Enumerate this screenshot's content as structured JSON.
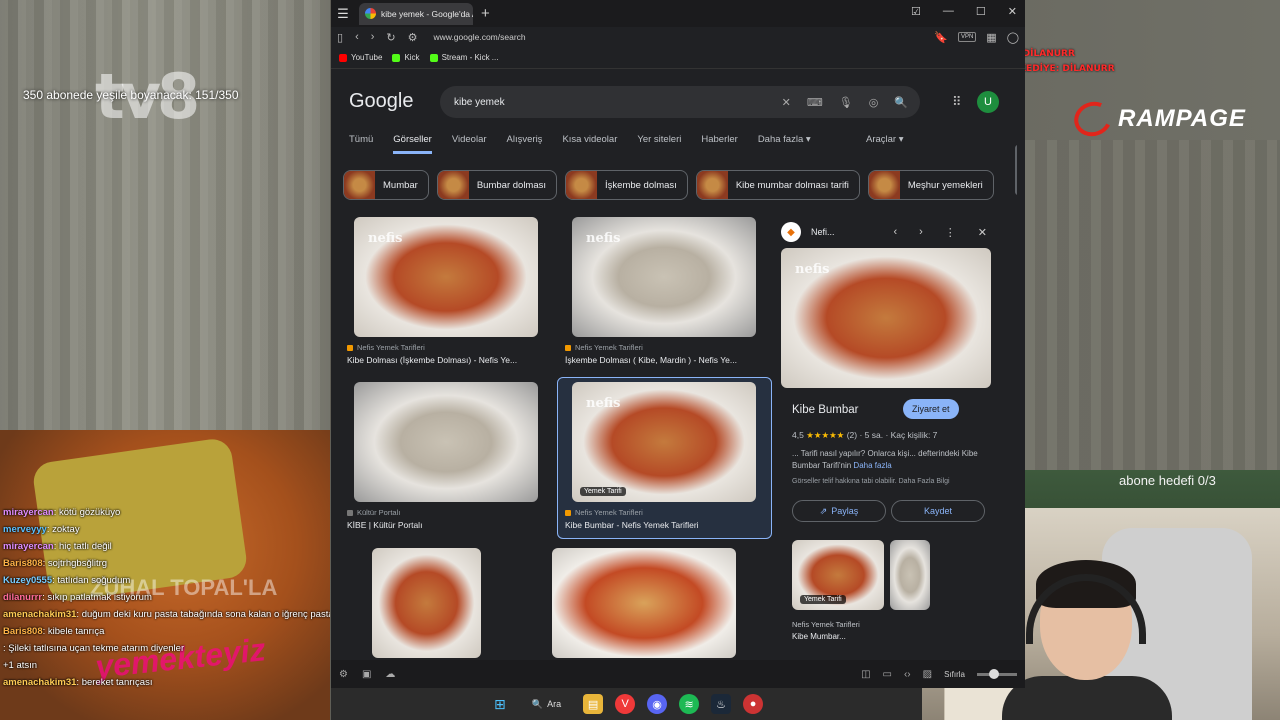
{
  "stream": {
    "abone_top": "350 abonede yeşile boyanacak: 151/350",
    "abone_hedef": "abone hedefi 0/3",
    "son_abone_1": "SON ABONE: DİLANURR",
    "son_abone_2": "SON ABONE KEDİYE: DİLANURR",
    "brand": "RAMPAGE",
    "logo_tv": "tv8",
    "watermark": "yemekteyiz",
    "watermark_top": "ZUHAL TOPAL'LA"
  },
  "chat": [
    {
      "user": "mirayercan",
      "text": ": kötü gözüküyo",
      "color": "#e08cff"
    },
    {
      "user": "merveyyy",
      "text": ": zoktay",
      "color": "#5bc0ff"
    },
    {
      "user": "mirayercan",
      "text": ": hiç tatlı değil",
      "color": "#e08cff"
    },
    {
      "user": "Baris808",
      "text": ": sojtrhgbsğlitrg",
      "color": "#ffb347"
    },
    {
      "user": "Kuzey0555",
      "text": ": tatlıdan soğudum",
      "color": "#7cf"
    },
    {
      "user": "dilanurrr",
      "text": ": sıkıp patlatmak istiyorum",
      "color": "#ff6b9a"
    },
    {
      "user": "amenachakim31",
      "text": ": duğum deki kuru pasta tabağında sona kalan o iğrenç pasta",
      "color": "#ffcc55"
    },
    {
      "user": "Baris808",
      "text": ": kibele tanrıça",
      "color": "#ffb347"
    },
    {
      "user": "",
      "text": ": Şileki tatlısına uçan tekme atarım diyenler",
      "color": "#fff"
    },
    {
      "user": "",
      "text": "+1 atsın",
      "color": "#fff"
    },
    {
      "user": "amenachakim31",
      "text": ": bereket tanrıçası",
      "color": "#ffcc55"
    }
  ],
  "browser": {
    "tab_title": "kibe yemek - Google'da Ara",
    "url": "www.google.com/search",
    "bookmarks": [
      "YouTube",
      "Kick",
      "Stream - Kick ..."
    ],
    "vpn": "VPN"
  },
  "google": {
    "logo": "Google",
    "query": "kibe yemek",
    "avatar": "U",
    "tabs": [
      "Tümü",
      "Görseller",
      "Videolar",
      "Alışveriş",
      "Kısa videolar",
      "Yer siteleri",
      "Haberler",
      "Daha fazla ▾"
    ],
    "tools": "Araçlar ▾",
    "chips": [
      "Mumbar",
      "Bumbar dolması",
      "İşkembe dolması",
      "Kibe mumbar dolması tarifi",
      "Meşhur yemekleri"
    ],
    "results": [
      {
        "source": "Nefis Yemek Tarifleri",
        "title": "Kibe Dolması (İşkembe Dolması) - Nefis Ye..."
      },
      {
        "source": "Nefis Yemek Tarifleri",
        "title": "İşkembe Dolması ( Kibe, Mardin ) - Nefis Ye..."
      },
      {
        "source": "Kültür Portalı",
        "title": "KİBE | Kültür Portalı"
      },
      {
        "source": "Nefis Yemek Tarifleri",
        "title": "Kibe Bumbar - Nefis Yemek Tarifleri",
        "tag": "Yemek Tarifi"
      }
    ],
    "panel": {
      "source": "Nefi...",
      "title": "Kibe Bumbar",
      "visit": "Ziyaret et",
      "rating": "4,5",
      "stars": "★★★★★",
      "rating_count": "(2)",
      "time": "5 sa.",
      "servings": "Kaç kişilik: 7",
      "desc": "... Tarifi nasıl yapılır? Onlarca kişi... defterindeki Kibe Bumbar Tarifi'nin",
      "more": "Daha fazla",
      "small": "Görseller telif hakkına tabi olabilir. Daha Fazla Bilgi",
      "share": "Paylaş",
      "save": "Kaydet",
      "related_tag": "Yemek Tarifi",
      "related_source": "Nefis Yemek Tarifleri",
      "related_title": "Kibe Mumbar..."
    }
  },
  "bottombar": {
    "reset": "Sıfırla"
  },
  "taskbar": {
    "search": "Ara"
  }
}
